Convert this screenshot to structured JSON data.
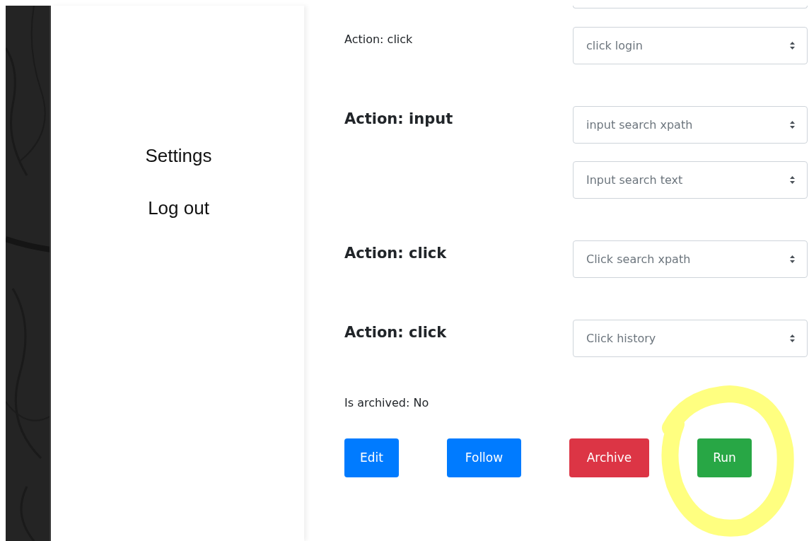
{
  "sidebar": {
    "items": [
      {
        "label": "Settings"
      },
      {
        "label": "Log out"
      }
    ]
  },
  "steps": [
    {
      "label": "Action: click",
      "bold": false,
      "selects": [
        {
          "value": "click login"
        }
      ]
    },
    {
      "label": "Action: input",
      "bold": true,
      "selects": [
        {
          "value": "input search xpath"
        },
        {
          "value": "Input search text"
        }
      ]
    },
    {
      "label": "Action: click",
      "bold": true,
      "selects": [
        {
          "value": "Click search xpath"
        }
      ]
    },
    {
      "label": "Action: click",
      "bold": true,
      "selects": [
        {
          "value": "Click history"
        }
      ]
    }
  ],
  "archived_status": "Is archived: No",
  "buttons": [
    {
      "label": "Edit",
      "kind": "primary",
      "circled": false
    },
    {
      "label": "Follow",
      "kind": "primary",
      "circled": false
    },
    {
      "label": "Archive",
      "kind": "danger",
      "circled": false
    },
    {
      "label": "Run",
      "kind": "success",
      "circled": true
    }
  ]
}
